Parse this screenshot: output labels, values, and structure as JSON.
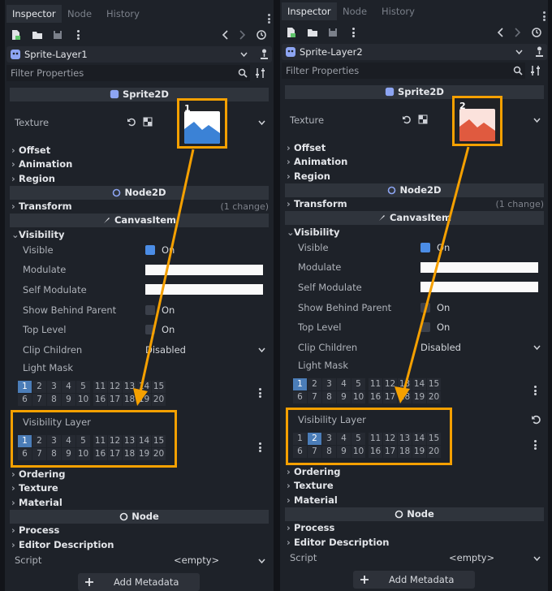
{
  "panels": [
    {
      "tabs": [
        "Inspector",
        "Node",
        "History"
      ],
      "object_name": "Sprite-Layer1",
      "filter_placeholder": "Filter Properties",
      "sprite_section": "Sprite2D",
      "texture_label": "Texture",
      "badge_number": "1",
      "texture_color": "#3b82d6",
      "cat_offset": "Offset",
      "cat_animation": "Animation",
      "cat_region": "Region",
      "node2d_section": "Node2D",
      "cat_transform": "Transform",
      "transform_hint": "(1 change)",
      "canvas_section": "CanvasItem",
      "cat_visibility": "Visibility",
      "visible_label": "Visible",
      "visible_value": "On",
      "modulate_label": "Modulate",
      "self_modulate_label": "Self Modulate",
      "show_behind_label": "Show Behind Parent",
      "show_behind_value": "On",
      "top_level_label": "Top Level",
      "top_level_value": "On",
      "clip_label": "Clip Children",
      "clip_value": "Disabled",
      "light_mask_label": "Light Mask",
      "light_mask_active": 1,
      "visibility_layer_label": "Visibility Layer",
      "visibility_layer_active": 1,
      "cat_ordering": "Ordering",
      "cat_texture": "Texture",
      "cat_material": "Material",
      "node_section": "Node",
      "cat_process": "Process",
      "cat_editor_desc": "Editor Description",
      "script_label": "Script",
      "script_value": "<empty>",
      "add_metadata": "Add Metadata"
    },
    {
      "tabs": [
        "Inspector",
        "Node",
        "History"
      ],
      "object_name": "Sprite-Layer2",
      "filter_placeholder": "Filter Properties",
      "sprite_section": "Sprite2D",
      "texture_label": "Texture",
      "badge_number": "2",
      "texture_color": "#e05a3f",
      "cat_offset": "Offset",
      "cat_animation": "Animation",
      "cat_region": "Region",
      "node2d_section": "Node2D",
      "cat_transform": "Transform",
      "transform_hint": "(1 change)",
      "canvas_section": "CanvasItem",
      "cat_visibility": "Visibility",
      "visible_label": "Visible",
      "visible_value": "On",
      "modulate_label": "Modulate",
      "self_modulate_label": "Self Modulate",
      "show_behind_label": "Show Behind Parent",
      "show_behind_value": "On",
      "top_level_label": "Top Level",
      "top_level_value": "On",
      "clip_label": "Clip Children",
      "clip_value": "Disabled",
      "light_mask_label": "Light Mask",
      "light_mask_active": 1,
      "visibility_layer_label": "Visibility Layer",
      "visibility_layer_active": 2,
      "cat_ordering": "Ordering",
      "cat_texture": "Texture",
      "cat_material": "Material",
      "node_section": "Node",
      "cat_process": "Process",
      "cat_editor_desc": "Editor Description",
      "script_label": "Script",
      "script_value": "<empty>",
      "add_metadata": "Add Metadata"
    }
  ],
  "layer_numbers": [
    "1",
    "2",
    "3",
    "4",
    "5",
    "11",
    "12",
    "13",
    "14",
    "15",
    "6",
    "7",
    "8",
    "9",
    "10",
    "16",
    "17",
    "18",
    "19",
    "20"
  ],
  "colors": {
    "highlight": "#f5a000",
    "accent": "#4b8de6"
  }
}
